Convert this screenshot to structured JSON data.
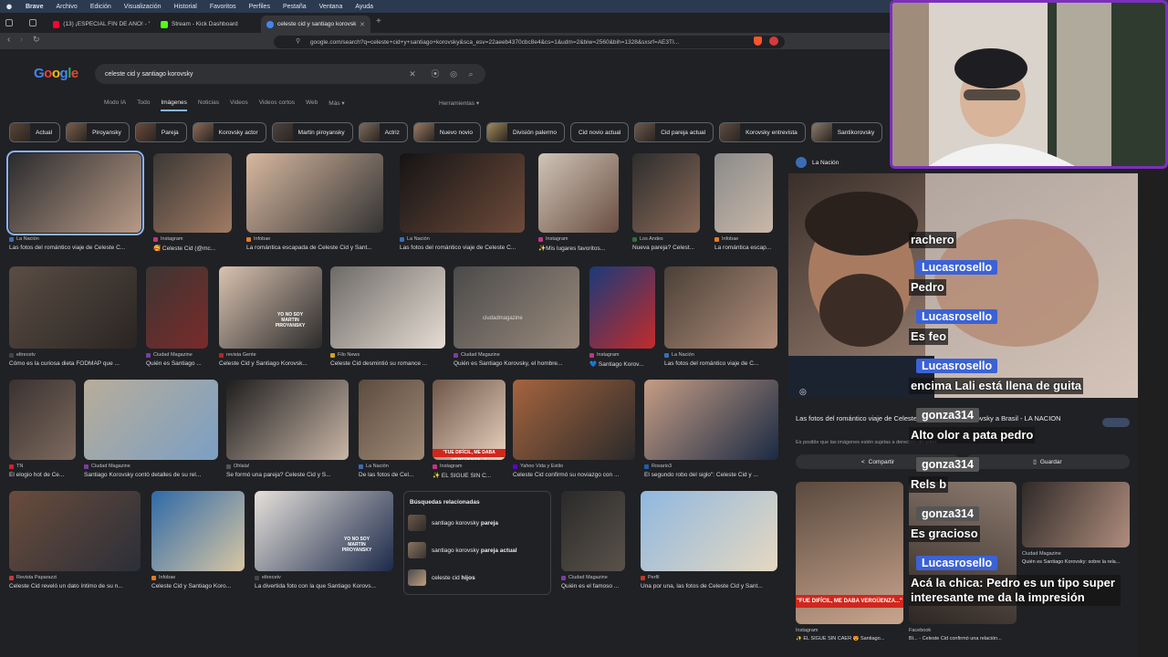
{
  "menubar": {
    "brand": "Brave",
    "items": [
      "Archivo",
      "Edición",
      "Visualización",
      "Historial",
      "Favoritos",
      "Perfiles",
      "Pestaña",
      "Ventana",
      "Ayuda"
    ]
  },
  "tabs": [
    {
      "title": "(13) ¡ESPECIAL FIN DE AÑO! - You",
      "color": "#ff0033"
    },
    {
      "title": "Stream - Kick Dashboard",
      "color": "#53fc18"
    },
    {
      "title": "celeste cid y santiago korovsk",
      "color": "#4285f4"
    }
  ],
  "address": {
    "url": "google.com/search?q=celeste+cid+y+santiago+korovsky&sca_esv=22aeeb4370cbc8e4&cs=1&udm=2&biw=2560&bih=1328&sxsrf=AE3TI..."
  },
  "google": {
    "logo_letters": [
      {
        "ch": "G",
        "color": "#4285f4"
      },
      {
        "ch": "o",
        "color": "#ea4335"
      },
      {
        "ch": "o",
        "color": "#fbbc05"
      },
      {
        "ch": "g",
        "color": "#4285f4"
      },
      {
        "ch": "l",
        "color": "#34a853"
      },
      {
        "ch": "e",
        "color": "#ea4335"
      }
    ],
    "query": "celeste cid y santiago korovsky",
    "nav_tabs": [
      "Modo IA",
      "Todo",
      "Imágenes",
      "Noticias",
      "Videos",
      "Videos cortos",
      "Web",
      "Más ▾"
    ],
    "active_tab": "Imágenes",
    "tools_label": "Herramientas ▾"
  },
  "chips": [
    {
      "label": "Actual",
      "img": true
    },
    {
      "label": "Piroyansky",
      "img": true
    },
    {
      "label": "Pareja",
      "img": true
    },
    {
      "label": "Korovsky actor",
      "img": true
    },
    {
      "label": "Martin piroyansky",
      "img": true
    },
    {
      "label": "Actriz",
      "img": true
    },
    {
      "label": "Nuevo novio",
      "img": true
    },
    {
      "label": "División palermo",
      "img": true
    },
    {
      "label": "Cid novio actual",
      "img": false
    },
    {
      "label": "Cid pareja actual",
      "img": true
    },
    {
      "label": "Korovsky entrevista",
      "img": true
    },
    {
      "label": "Santikorovsky",
      "img": true
    }
  ],
  "results": [
    {
      "source": "La Nación",
      "title": "Las fotos del romántico viaje de Celeste C..."
    },
    {
      "source": "Instagram",
      "title": "🥰 Celeste Cid (@mc..."
    },
    {
      "source": "Infobae",
      "title": "La romántica escapada de Celeste Cid y Sant..."
    },
    {
      "source": "La Nación",
      "title": "Las fotos del romántico viaje de Celeste C..."
    },
    {
      "source": "Instagram",
      "title": "✨Mis lugares favoritos..."
    },
    {
      "source": "Los Andes",
      "title": "Nueva pareja? Celest..."
    },
    {
      "source": "Infobae",
      "title": "La romántica escap..."
    },
    {
      "source": "eltrecetv",
      "title": "Cómo es la curiosa dieta FODMAP que ..."
    },
    {
      "source": "Ciudad Magazine",
      "title": "Quién es Santiago ..."
    },
    {
      "source": "revista Gente",
      "title": "Celeste Cid y Santiago Korovsk..."
    },
    {
      "source": "Filo News",
      "title": "Celeste Cid desmintió su romance ..."
    },
    {
      "source": "Ciudad Magazine",
      "title": "Quién es Santiago Korovsky, el hombre..."
    },
    {
      "source": "Instagram",
      "title": "💙 Santiago Korov..."
    },
    {
      "source": "La Nación",
      "title": "Las fotos del romántico viaje de C..."
    },
    {
      "source": "TN",
      "title": "El elogio hot de Ce..."
    },
    {
      "source": "Ciudad Magazine",
      "title": "Santiago Korovsky contó detalles de su rel..."
    },
    {
      "source": "Ohlala!",
      "title": "Se formó una pareja? Celeste Cid y S..."
    },
    {
      "source": "La Nación",
      "title": "De las fotos de Cel..."
    },
    {
      "source": "Instagram",
      "title": "✨ EL SIGUE SIN C..."
    },
    {
      "source": "Yahoo Vida y Estilo",
      "title": "Celeste Cid confirmó su noviazgo con ..."
    },
    {
      "source": "Rosario3",
      "title": "El segundo robo del siglo\": Celeste Cid y ..."
    },
    {
      "source": "Revista Paparazzi",
      "title": "Celeste Cid reveló un dato íntimo de su n..."
    },
    {
      "source": "Infobae",
      "title": "Celeste Cid y Santiago Koro..."
    },
    {
      "source": "eltrecetv",
      "title": "La divertida foto con la que Santiago Korovs..."
    },
    {
      "source": "Ciudad Magazine",
      "title": "Quién es el famoso ..."
    },
    {
      "source": "Perfil",
      "title": "Una por una, las fotos de Celeste Cid y Sant..."
    }
  ],
  "related": {
    "heading": "Búsquedas relacionadas",
    "items": [
      {
        "pre": "santiago korovsky ",
        "bold": "pareja"
      },
      {
        "pre": "santiago korovsky ",
        "bold": "pareja actual"
      },
      {
        "pre": "celeste cid ",
        "bold": "hijos"
      }
    ]
  },
  "captions": {
    "shirt": "YO NO SOY MARTIN PIROYANSKY",
    "quote": "\"FUE DIFÍCIL, ME DABA VERGÜENZA...\"",
    "watermark": "ciudadmagazine"
  },
  "preview": {
    "source": "La Nación",
    "title": "Las fotos del romántico viaje de Celeste Cid y Santiago Korovsky a Brasil - LA NACION",
    "note": "Es posible que las imágenes estén sujetas a derechos de autor.",
    "share": "Compartir",
    "save": "Guardar",
    "thumbs": [
      {
        "source": "Instagram",
        "title": "✨ EL SIGUE SIN CAER 😍 Santiago..."
      },
      {
        "source": "Facebook",
        "title": "BI... - Celeste Cid confirmó una relación..."
      },
      {
        "source": "Ciudad Magazine",
        "title": "Quién es Santiago Korovsky: sobre la rela..."
      }
    ]
  },
  "chat": [
    {
      "text": "rachero"
    },
    {
      "user": "Lucasrosello",
      "text": "Pedro",
      "color": "#3b62d6"
    },
    {
      "user": "Lucasrosello",
      "text": "Es feo",
      "color": "#3b62d6"
    },
    {
      "user": "Lucasrosello",
      "text": "encima Lali está llena de guita",
      "color": "#3b62d6"
    },
    {
      "user": "gonza314",
      "text": "Alto olor a pata pedro",
      "color": "#555555"
    },
    {
      "user": "gonza314",
      "text": "Rels b",
      "color": "#555555"
    },
    {
      "user": "gonza314",
      "text": "Es gracioso",
      "color": "#555555"
    },
    {
      "user": "Lucasrosello",
      "text": "Acá la chica: Pedro es un tipo super interesante me da la impresión",
      "color": "#3b62d6"
    }
  ]
}
